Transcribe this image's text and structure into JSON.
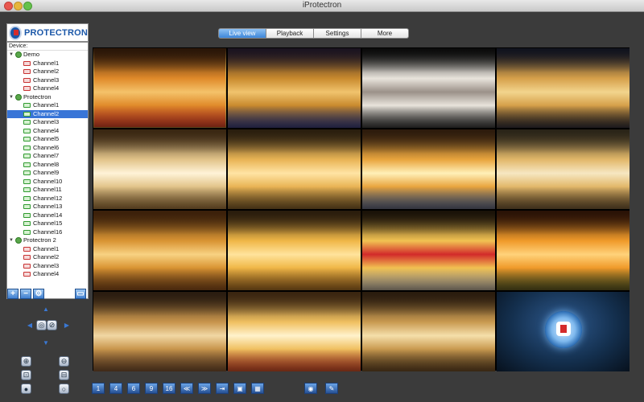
{
  "window": {
    "title": "iProtectron"
  },
  "tabs": [
    "Live view",
    "Playback",
    "Settings",
    "More"
  ],
  "active_tab": "Live view",
  "logo": {
    "text": "PROTECTRON"
  },
  "devices": {
    "header": "Device:",
    "rows": [
      {
        "kind": "group",
        "label": "Demo"
      },
      {
        "kind": "channel",
        "label": "Channel1",
        "color": "red"
      },
      {
        "kind": "channel",
        "label": "Channel2",
        "color": "red"
      },
      {
        "kind": "channel",
        "label": "Channel3",
        "color": "red"
      },
      {
        "kind": "channel",
        "label": "Channel4",
        "color": "red"
      },
      {
        "kind": "group",
        "label": "Protectron"
      },
      {
        "kind": "channel",
        "label": "Channel1",
        "color": "green"
      },
      {
        "kind": "channel",
        "label": "Channel2",
        "color": "green",
        "selected": true
      },
      {
        "kind": "channel",
        "label": "Channel3",
        "color": "green"
      },
      {
        "kind": "channel",
        "label": "Channel4",
        "color": "green"
      },
      {
        "kind": "channel",
        "label": "Channel5",
        "color": "green"
      },
      {
        "kind": "channel",
        "label": "Channel6",
        "color": "green"
      },
      {
        "kind": "channel",
        "label": "Channel7",
        "color": "green"
      },
      {
        "kind": "channel",
        "label": "Channel8",
        "color": "green"
      },
      {
        "kind": "channel",
        "label": "Channel9",
        "color": "green"
      },
      {
        "kind": "channel",
        "label": "Channel10",
        "color": "green"
      },
      {
        "kind": "channel",
        "label": "Channel11",
        "color": "green"
      },
      {
        "kind": "channel",
        "label": "Channel12",
        "color": "green"
      },
      {
        "kind": "channel",
        "label": "Channel13",
        "color": "green"
      },
      {
        "kind": "channel",
        "label": "Channel14",
        "color": "green"
      },
      {
        "kind": "channel",
        "label": "Channel15",
        "color": "green"
      },
      {
        "kind": "channel",
        "label": "Channel16",
        "color": "green"
      },
      {
        "kind": "group",
        "label": "Protectron 2"
      },
      {
        "kind": "channel",
        "label": "Channel1",
        "color": "red"
      },
      {
        "kind": "channel",
        "label": "Channel2",
        "color": "red"
      },
      {
        "kind": "channel",
        "label": "Channel3",
        "color": "red"
      },
      {
        "kind": "channel",
        "label": "Channel4",
        "color": "red"
      }
    ]
  },
  "video_grid": {
    "layout": "4x4",
    "tiles": [
      {
        "scene": "Castle facade lit at night"
      },
      {
        "scene": "Arabian arches interior"
      },
      {
        "scene": "White sports car"
      },
      {
        "scene": "Illuminated Arabic building at night"
      },
      {
        "scene": "Mall atrium with shoppers"
      },
      {
        "scene": "Arched mall corridor"
      },
      {
        "scene": "Ornate hall with dome lamp"
      },
      {
        "scene": "Multi-level mall balconies"
      },
      {
        "scene": "Golden arched hall"
      },
      {
        "scene": "Mall atrium escalators"
      },
      {
        "scene": "Car showroom floor"
      },
      {
        "scene": "Lounge with lanterns and restaurant"
      },
      {
        "scene": "Shop with shelves and sofa"
      },
      {
        "scene": "Ice rink in mall"
      },
      {
        "scene": "Food court atrium from above"
      },
      {
        "scene": "empty",
        "empty": true
      }
    ]
  },
  "colors": {
    "accent": "#3d86d9",
    "selection": "#3875d7",
    "tile_border": "#d7a94a"
  },
  "ptz_controls": [
    {
      "name": "add-button",
      "icon": "+"
    },
    {
      "name": "remove-button",
      "icon": "−"
    },
    {
      "name": "camera-settings-button",
      "icon": "⚙"
    },
    {
      "name": "fullscreen-button",
      "icon": "▭"
    }
  ],
  "bottom_toolbar": [
    {
      "name": "layout-1-button",
      "icon": "1"
    },
    {
      "name": "layout-4-button",
      "icon": "4"
    },
    {
      "name": "layout-6-button",
      "icon": "6"
    },
    {
      "name": "layout-9-button",
      "icon": "9"
    },
    {
      "name": "layout-16-button",
      "icon": "16"
    },
    {
      "name": "prev-page-button",
      "icon": "≪"
    },
    {
      "name": "next-page-button",
      "icon": "≫"
    },
    {
      "name": "sequence-button",
      "icon": "⇥"
    },
    {
      "name": "single-view-button",
      "icon": "▣"
    },
    {
      "name": "multi-view-button",
      "icon": "▦"
    },
    {
      "name": "snapshot-button",
      "icon": "◉"
    },
    {
      "name": "record-button",
      "icon": "✎"
    }
  ]
}
